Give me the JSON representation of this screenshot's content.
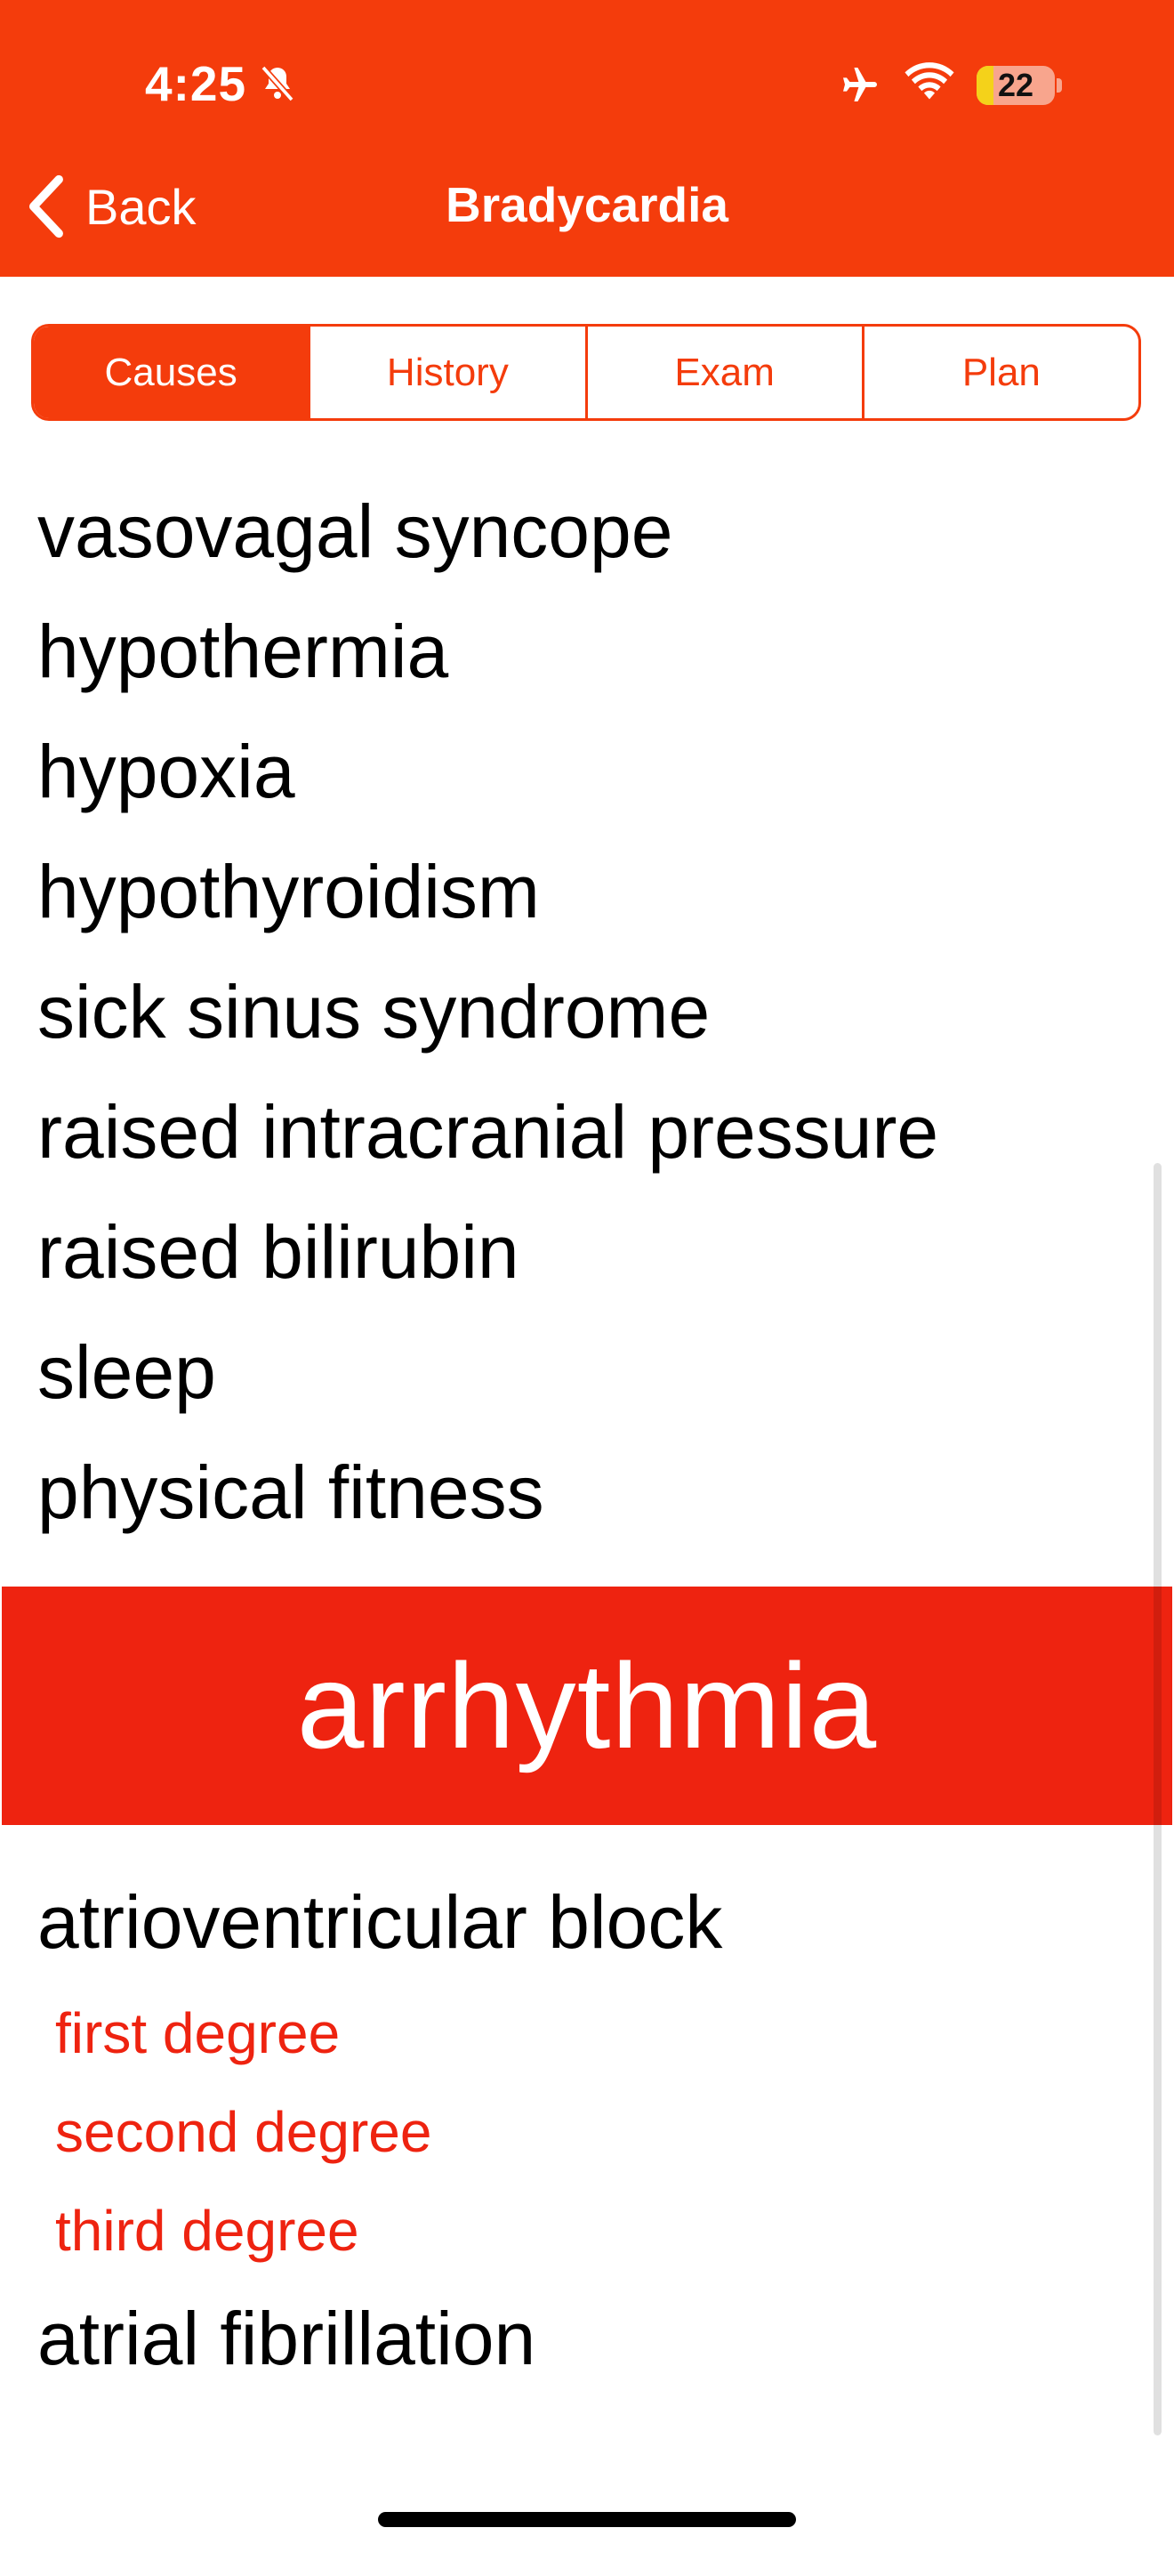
{
  "status_bar": {
    "time": "4:25",
    "battery_level": "22",
    "battery_fraction": 0.22
  },
  "nav": {
    "back_label": "Back",
    "title": "Bradycardia"
  },
  "tabs": [
    {
      "label": "Causes",
      "active": true
    },
    {
      "label": "History",
      "active": false
    },
    {
      "label": "Exam",
      "active": false
    },
    {
      "label": "Plan",
      "active": false
    }
  ],
  "causes": [
    "vasovagal syncope",
    "hypothermia",
    "hypoxia",
    "hypothyroidism",
    "sick sinus syndrome",
    "raised intracranial pressure",
    "raised bilirubin",
    "sleep",
    "physical fitness"
  ],
  "section": {
    "title": "arrhythmia",
    "items": [
      {
        "label": "atrioventricular block",
        "subitems": [
          "first degree",
          "second degree",
          "third degree"
        ]
      },
      {
        "label": "atrial fibrillation"
      }
    ]
  },
  "colors": {
    "accent": "#f43c0c",
    "banner": "#ee2310",
    "subitem_text": "#ee2310"
  }
}
